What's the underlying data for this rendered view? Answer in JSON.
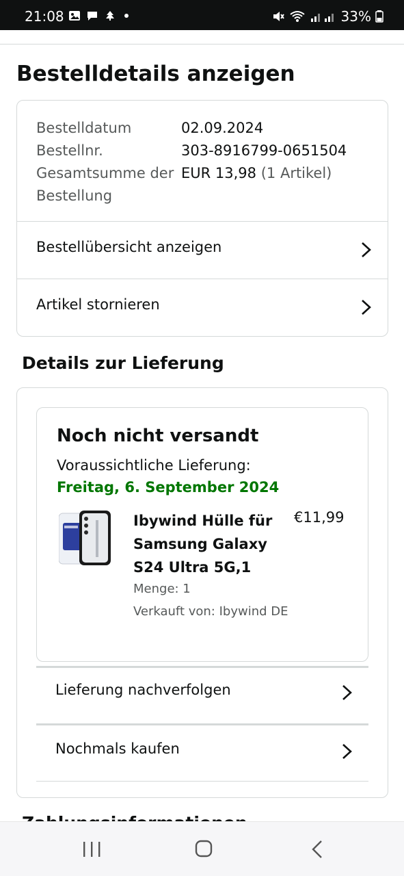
{
  "status_bar": {
    "time": "21:08",
    "battery": "33%",
    "left_icons": [
      "gallery-icon",
      "chat-icon",
      "tree-icon"
    ],
    "right_icons": [
      "mute-icon",
      "wifi-icon",
      "signal-icon"
    ]
  },
  "page": {
    "title": "Bestelldetails anzeigen"
  },
  "order_info": {
    "date_label": "Bestelldatum",
    "date_value": "02.09.2024",
    "number_label": "Bestellnr.",
    "number_value": "303-8916799-0651504",
    "total_label": "Gesamtsumme der Bestellung",
    "total_value": "EUR 13,98",
    "total_count": "(1 Artikel)"
  },
  "order_links": [
    {
      "label": "Bestellübersicht anzeigen"
    },
    {
      "label": "Artikel stornieren"
    }
  ],
  "delivery": {
    "section_title": "Details zur Lieferung",
    "status": "Noch nicht versandt",
    "estimate_label": "Voraussichtliche Lieferung:",
    "estimate_date": "Freitag, 6. September 2024",
    "date_color": "#007600",
    "item": {
      "title": "Ibywind Hülle für Samsung Galaxy S24 Ultra 5G,1",
      "price": "€11,99",
      "quantity": "Menge: 1",
      "seller": "Verkauft von: Ibywind DE"
    },
    "links": [
      {
        "label": "Lieferung nachverfolgen"
      },
      {
        "label": "Nochmals kaufen"
      }
    ]
  },
  "next_section_title": "Zahlungsinformationen",
  "nav_bar": {
    "buttons": [
      "recent-apps-icon",
      "home-icon",
      "back-icon"
    ]
  }
}
